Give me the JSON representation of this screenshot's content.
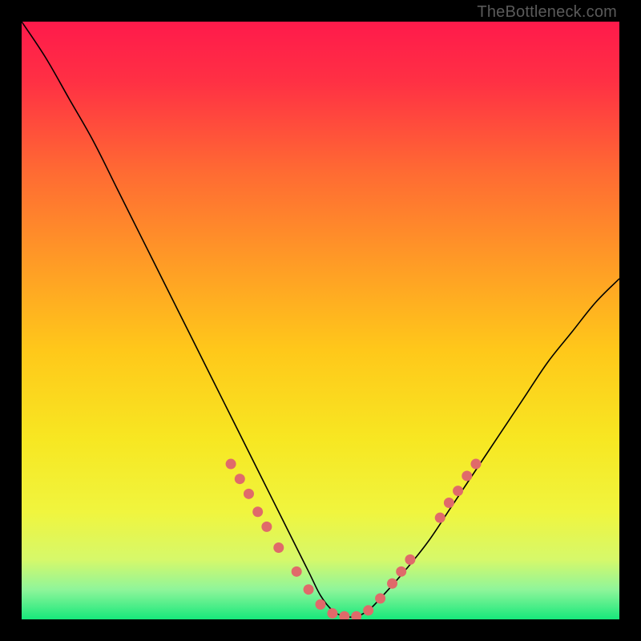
{
  "watermark": "TheBottleneck.com",
  "colors": {
    "page_bg": "#000000",
    "gradient_stops": [
      {
        "offset": 0.0,
        "color": "#ff1a4b"
      },
      {
        "offset": 0.1,
        "color": "#ff3044"
      },
      {
        "offset": 0.25,
        "color": "#ff6a33"
      },
      {
        "offset": 0.4,
        "color": "#ff9a26"
      },
      {
        "offset": 0.55,
        "color": "#ffc81a"
      },
      {
        "offset": 0.7,
        "color": "#f7e722"
      },
      {
        "offset": 0.82,
        "color": "#f0f53e"
      },
      {
        "offset": 0.9,
        "color": "#d6f86a"
      },
      {
        "offset": 0.95,
        "color": "#8ff59a"
      },
      {
        "offset": 1.0,
        "color": "#17e87b"
      }
    ],
    "curve": "#000000",
    "marker_fill": "#e06a6a",
    "marker_stroke": "#c24f4f"
  },
  "chart_data": {
    "type": "line",
    "title": "",
    "xlabel": "",
    "ylabel": "",
    "xlim": [
      0,
      100
    ],
    "ylim": [
      0,
      100
    ],
    "grid": false,
    "legend": false,
    "series": [
      {
        "name": "bottleneck-curve",
        "x": [
          0,
          4,
          8,
          12,
          16,
          20,
          24,
          28,
          32,
          36,
          40,
          44,
          48,
          50,
          52,
          54,
          56,
          58,
          60,
          64,
          68,
          72,
          76,
          80,
          84,
          88,
          92,
          96,
          100
        ],
        "y": [
          100,
          94,
          87,
          80,
          72,
          64,
          56,
          48,
          40,
          32,
          24,
          16,
          8,
          4,
          1.5,
          0.5,
          0.5,
          1.5,
          3.5,
          8,
          13,
          19,
          25,
          31,
          37,
          43,
          48,
          53,
          57
        ]
      }
    ],
    "highlighted_points": {
      "name": "highlight-cluster",
      "x": [
        35,
        36.5,
        38,
        39.5,
        41,
        43,
        46,
        48,
        50,
        52,
        54,
        56,
        58,
        60,
        62,
        63.5,
        65,
        70,
        71.5,
        73,
        74.5,
        76
      ],
      "y": [
        26,
        23.5,
        21,
        18,
        15.5,
        12,
        8,
        5,
        2.5,
        1,
        0.5,
        0.5,
        1.5,
        3.5,
        6,
        8,
        10,
        17,
        19.5,
        21.5,
        24,
        26
      ]
    },
    "annotations": []
  }
}
